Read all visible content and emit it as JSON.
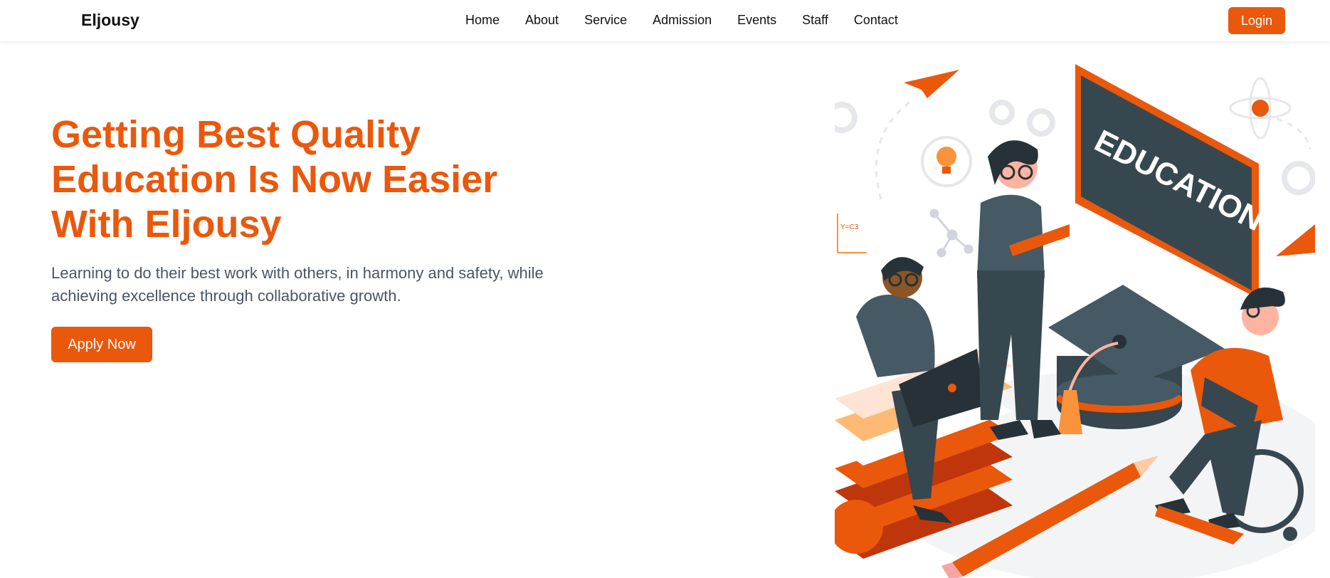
{
  "header": {
    "brand": "Eljousy",
    "nav": [
      "Home",
      "About",
      "Service",
      "Admission",
      "Events",
      "Staff",
      "Contact"
    ],
    "login_label": "Login"
  },
  "hero": {
    "title": "Getting Best Quality Education Is Now Easier With Eljousy",
    "subtitle": "Learning to do their best work with others, in harmony and safety, while achieving excellence through collaborative growth.",
    "cta_label": "Apply Now",
    "illustration": {
      "chalkboard_text": "EDUCATION",
      "formula_text": "Y=C3"
    }
  },
  "colors": {
    "accent": "#ea580c",
    "text": "#111111",
    "muted": "#4b5563",
    "dark_figure": "#37474f"
  }
}
